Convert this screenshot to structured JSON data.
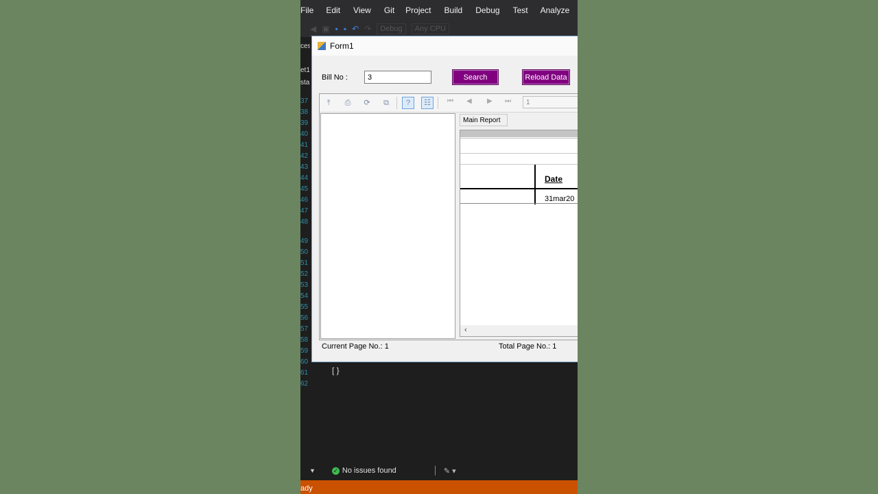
{
  "menu": [
    "File",
    "Edit",
    "View",
    "Git",
    "Project",
    "Build",
    "Debug",
    "Test",
    "Analyze"
  ],
  "vs_toolbar": {
    "config": "Debug",
    "platform": "Any CPU"
  },
  "side_tabs": [
    "ces",
    "et1",
    "sta"
  ],
  "line_numbers": [
    "37",
    "38",
    "39",
    "40",
    "41",
    "42",
    "43",
    "44",
    "45",
    "46",
    "47",
    "48",
    "49",
    "50",
    "51",
    "52",
    "53",
    "54",
    "55",
    "56",
    "57",
    "58",
    "59",
    "60",
    "61",
    "62"
  ],
  "code_brace": "[ }",
  "form": {
    "title": "Form1",
    "bill_label": "Bill No :",
    "bill_value": "3",
    "search_label": "Search",
    "reload_label": "Reload Data"
  },
  "viewer": {
    "page_input": "1",
    "tab_label": "Main Report",
    "date_header": "Date",
    "date_value": "31mar20",
    "current_page": "Current Page No.: 1",
    "total_page": "Total Page No.: 1"
  },
  "status": {
    "issues": "No issues found",
    "ready": "ady"
  },
  "colors": {
    "accent": "#800080",
    "status_bar": "#ca5100",
    "background": "#6a8560"
  }
}
